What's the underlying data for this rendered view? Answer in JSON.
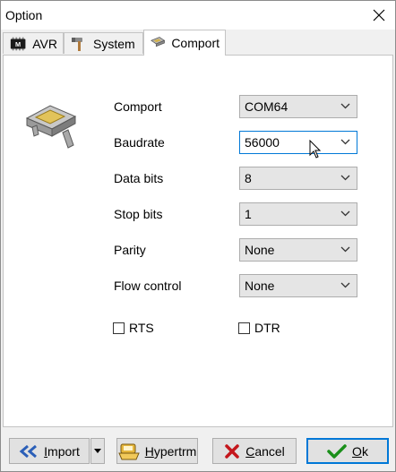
{
  "window": {
    "title": "Option"
  },
  "tabs": [
    {
      "label": "AVR",
      "icon": "chip-icon"
    },
    {
      "label": "System",
      "icon": "hammer-icon"
    },
    {
      "label": "Comport",
      "icon": "serial-port-icon"
    }
  ],
  "form": {
    "fields": [
      {
        "label": "Comport",
        "value": "COM64"
      },
      {
        "label": "Baudrate",
        "value": "56000"
      },
      {
        "label": "Data bits",
        "value": "8"
      },
      {
        "label": "Stop bits",
        "value": "1"
      },
      {
        "label": "Parity",
        "value": "None"
      },
      {
        "label": "Flow control",
        "value": "None"
      }
    ],
    "checks": [
      {
        "label": "RTS",
        "checked": false
      },
      {
        "label": "DTR",
        "checked": false
      }
    ]
  },
  "buttons": {
    "import": {
      "first": "I",
      "rest": "mport"
    },
    "hypertrm": {
      "first": "H",
      "rest": "ypertrm"
    },
    "cancel": {
      "first": "C",
      "rest": "ancel"
    },
    "ok": {
      "first": "O",
      "rest": "k"
    }
  },
  "colors": {
    "accent": "#0078d7",
    "cancel": "#c4161c",
    "ok": "#1a8f1a",
    "import": "#2b5fb8"
  }
}
